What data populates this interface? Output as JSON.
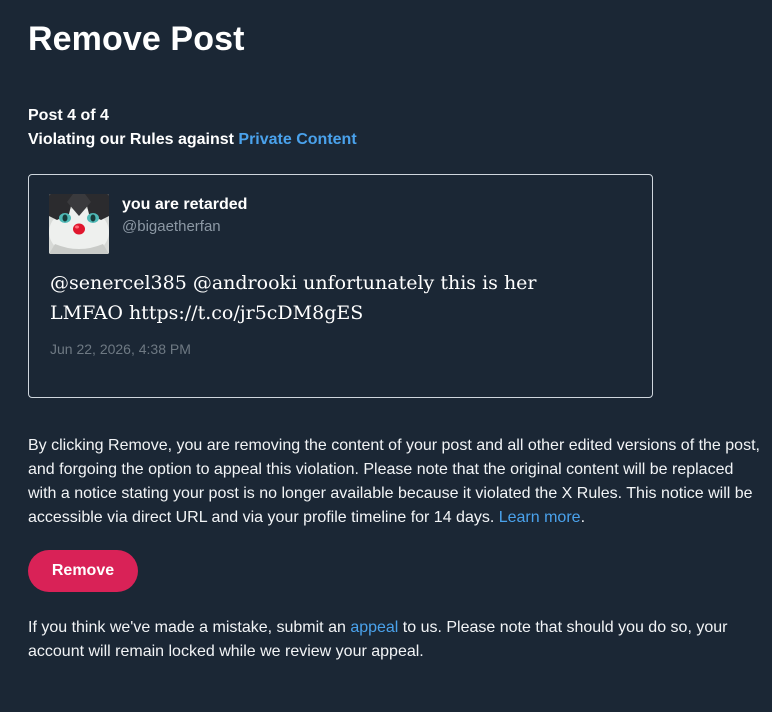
{
  "page_title": "Remove Post",
  "post_counter": "Post 4 of 4",
  "violation": {
    "prefix": "Violating our Rules against ",
    "link_text": "Private Content"
  },
  "post": {
    "author_name": "you are retarded",
    "author_handle": "@bigaetherfan",
    "text": "@senercel385 @androoki unfortunately this is her LMFAO https://t.co/jr5cDM8gES",
    "timestamp": "Jun 22, 2026, 4:38 PM",
    "avatar_icon": "cat-avatar-icon"
  },
  "notice": {
    "text": "By clicking Remove, you are removing the content of your post and all other edited versions of the post, and forgoing the option to appeal this violation. Please note that the original content will be replaced with a notice stating your post is no longer available because it violated the X Rules. This notice will be accessible via direct URL and via your profile timeline for 14 days. ",
    "learn_more_link": "Learn more",
    "suffix": "."
  },
  "remove_button_label": "Remove",
  "footer": {
    "prefix": "If you think we've made a mistake, submit an ",
    "appeal_link": "appeal",
    "suffix": " to us. Please note that should you do so, your account will remain locked while we review your appeal."
  },
  "colors": {
    "background": "#1b2735",
    "link": "#4aa2ec",
    "remove_button": "#d92257",
    "muted_text": "#8c98a4"
  }
}
